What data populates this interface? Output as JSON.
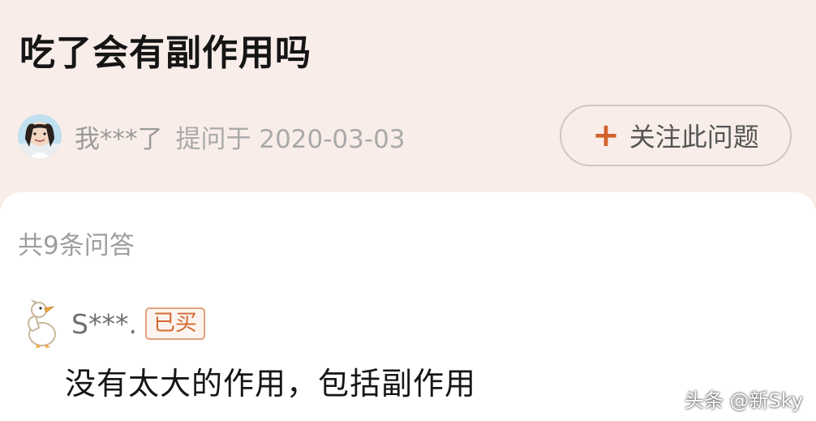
{
  "question": {
    "title": "吃了会有副作用吗",
    "asker_name": "我***了",
    "asked_on": "提问于 2020-03-03",
    "follow_icon": "+",
    "follow_label": "关注此问题"
  },
  "answers": {
    "count_label": "共9条问答",
    "items": [
      {
        "user": "S***.",
        "badge": "已买",
        "text": "没有太大的作用，包括副作用"
      }
    ]
  },
  "watermark": "头条 @新Sky",
  "colors": {
    "accent": "#d2622a",
    "background_top": "#f8ede8",
    "card": "#ffffff"
  }
}
